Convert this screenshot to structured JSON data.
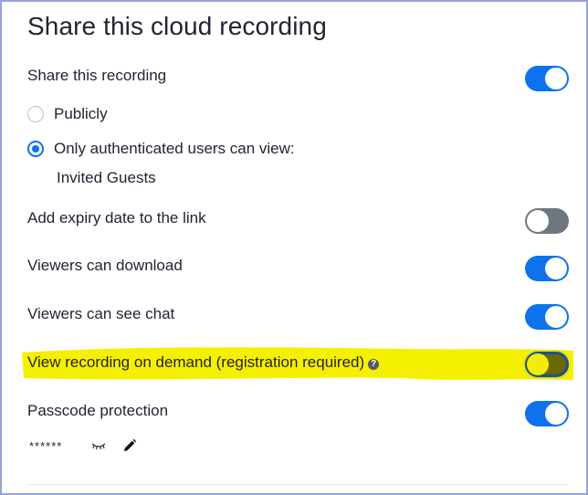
{
  "dialog": {
    "title": "Share this cloud recording"
  },
  "share": {
    "label": "Share this recording",
    "enabled": true
  },
  "access": {
    "options": [
      {
        "label": "Publicly",
        "selected": false
      },
      {
        "label": "Only authenticated users can view:",
        "selected": true
      }
    ],
    "sub_label": "Invited Guests"
  },
  "settings": [
    {
      "label": "Add expiry date to the link",
      "enabled": false
    },
    {
      "label": "Viewers can download",
      "enabled": true
    },
    {
      "label": "Viewers can see chat",
      "enabled": true
    },
    {
      "label": "View recording on demand (registration required)",
      "enabled": false,
      "help_icon": "question-circle-icon",
      "highlighted": true
    },
    {
      "label": "Passcode protection",
      "enabled": true
    }
  ],
  "passcode": {
    "value": "******",
    "reveal_icon": "eye-closed-icon",
    "edit_icon": "pencil-icon"
  },
  "colors": {
    "toggle_on": "#0e72ed",
    "toggle_off": "#6e7680",
    "highlight": "#f5f000",
    "text": "#232333"
  }
}
